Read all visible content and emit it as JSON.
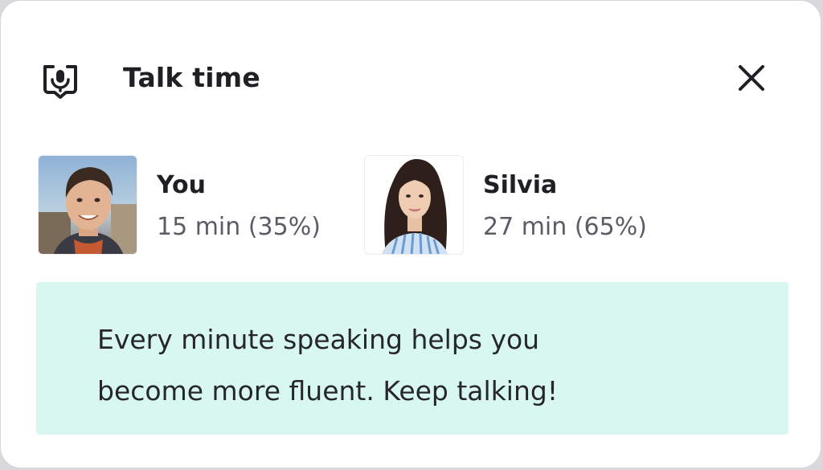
{
  "header": {
    "title": "Talk time",
    "icon": "microphone-bubble-icon",
    "close_icon": "close-icon"
  },
  "participants": [
    {
      "name": "You",
      "time": "15 min (35%)",
      "share": 35,
      "avatar": "user-photo"
    },
    {
      "name": "Silvia",
      "time": "27 min (65%)",
      "share": 65,
      "avatar": "tutor-photo"
    }
  ],
  "tip": {
    "line1": "Every minute speaking helps you",
    "line2": "become more fluent. Keep talking!"
  },
  "colors": {
    "tip_background": "#d8f7f0",
    "text_primary": "#1f1f24",
    "text_secondary": "#5c5c66"
  }
}
